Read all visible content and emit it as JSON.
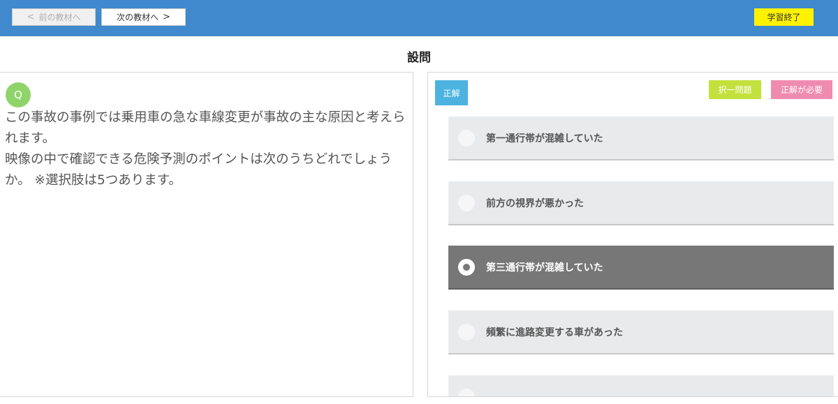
{
  "header": {
    "prev_label": "前の教材へ",
    "next_label": "次の教材へ",
    "finish_label": "学習終了"
  },
  "section_title": "設問",
  "question": {
    "badge": "Q",
    "text": "この事故の事例では乗用車の急な車線変更が事故の主な原因と考えられます。\n映像の中で確認できる危険予測のポイントは次のうちどれでしょうか。 ※選択肢は5つあります。"
  },
  "answer": {
    "tags": {
      "correct": "正解",
      "pick_one": "択一問題",
      "required": "正解が必要"
    },
    "choices": [
      {
        "label": "第一通行帯が混雑していた",
        "selected": false
      },
      {
        "label": "前方の視界が悪かった",
        "selected": false
      },
      {
        "label": "第三通行帯が混雑していた",
        "selected": true
      },
      {
        "label": "頻繁に進路変更する車があった",
        "selected": false
      },
      {
        "label": "",
        "selected": false
      }
    ]
  },
  "colors": {
    "header_bg": "#3f89cc",
    "finish_bg": "#fff200",
    "q_badge": "#8fd46a",
    "tag_correct": "#4cb3e0",
    "tag_pick_one": "#c3e03c",
    "tag_required": "#f08bb0",
    "choice_selected": "#777777"
  }
}
